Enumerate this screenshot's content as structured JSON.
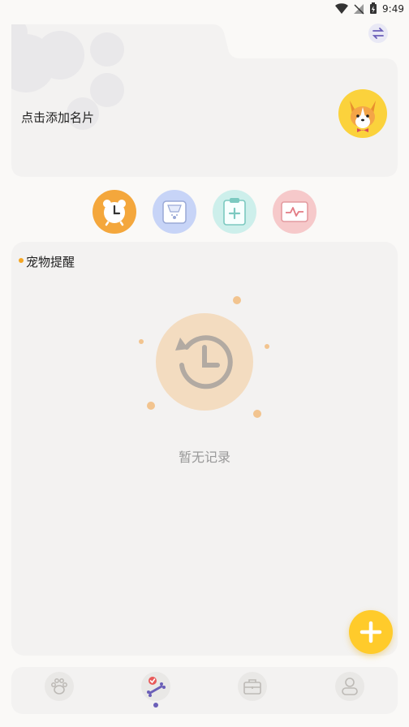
{
  "status_bar": {
    "time": "9:49"
  },
  "card": {
    "add_card_label": "点击添加名片"
  },
  "quick_actions": [
    {
      "name": "alarm",
      "color": "#f4a73c"
    },
    {
      "name": "scale",
      "color": "#c7d4f7"
    },
    {
      "name": "clipboard",
      "color": "#cdefeb"
    },
    {
      "name": "monitor",
      "color": "#f6c9ca"
    }
  ],
  "reminders": {
    "title": "宠物提醒",
    "empty_text": "暂无记录"
  },
  "colors": {
    "accent": "#ffcb2b",
    "nav_active_dot": "#6b5fb8",
    "empty_circle": "#f3dcc0"
  },
  "bottom_nav": {
    "items": [
      "paw-icon",
      "bone-icon",
      "briefcase-icon",
      "profile-icon"
    ],
    "active_index": 1
  }
}
